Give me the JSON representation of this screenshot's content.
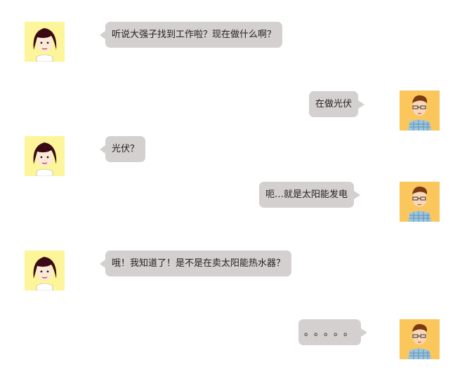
{
  "colors": {
    "bubble": "#d3d0cf",
    "girl_avatar_bg": "#fdf59a",
    "boy_avatar_bg": "#fbc65b"
  },
  "avatars": {
    "girl": "girl-avatar-icon",
    "boy": "boy-avatar-icon"
  },
  "messages": [
    {
      "side": "left",
      "text": "听说大强子找到工作啦？现在做什么啊？"
    },
    {
      "side": "right",
      "text": "在做光伏"
    },
    {
      "side": "left",
      "text": "光伏？"
    },
    {
      "side": "right",
      "text": "呃…就是太阳能发电"
    },
    {
      "side": "left",
      "text": "哦！我知道了！是不是在卖太阳能热水器？"
    },
    {
      "side": "right",
      "text": "。。。。。"
    }
  ]
}
